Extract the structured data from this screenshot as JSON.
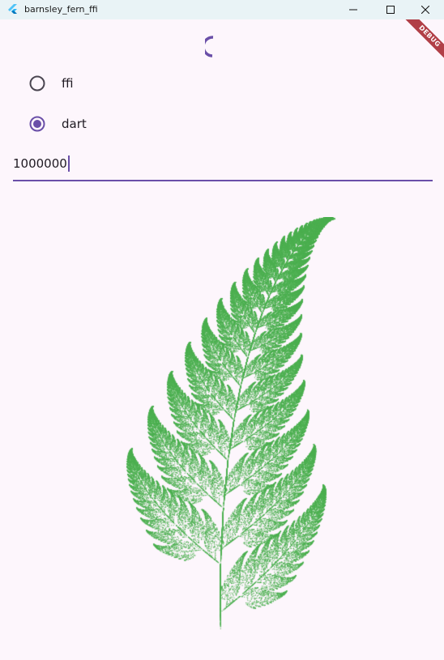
{
  "window": {
    "title": "barnsley_fern_ffi",
    "debug_banner": "DEBUG"
  },
  "colors": {
    "background": "#fdf6fc",
    "accent": "#6a4fa8",
    "fern": "#4caf50",
    "debug": "#b13f47"
  },
  "options": [
    {
      "label": "ffi",
      "selected": false
    },
    {
      "label": "dart",
      "selected": true
    }
  ],
  "input": {
    "value": "1000000"
  },
  "status": {
    "loading": true
  },
  "icons": {
    "app": "flutter-logo-icon",
    "minimize": "minimize-icon",
    "maximize": "maximize-icon",
    "close": "close-icon"
  }
}
